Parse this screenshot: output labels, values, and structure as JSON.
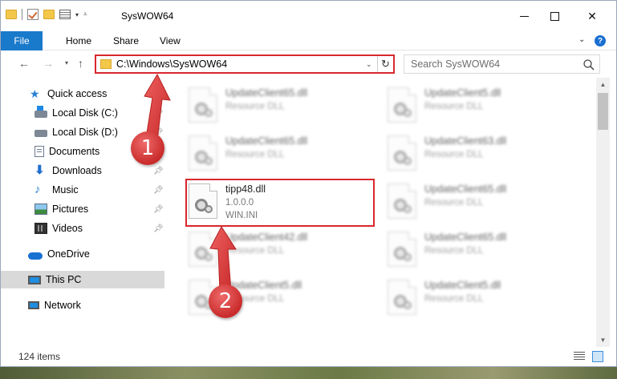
{
  "window": {
    "title": "SysWOW64"
  },
  "ribbon": {
    "tabs": [
      "File",
      "Home",
      "Share",
      "View"
    ],
    "help": "?"
  },
  "navigation": {
    "address": "C:\\Windows\\SysWOW64",
    "search_placeholder": "Search SysWOW64"
  },
  "sidebar": {
    "items": [
      {
        "label": "Quick access",
        "icon": "star-icon"
      },
      {
        "label": "Local Disk (C:)",
        "icon": "drive-icon",
        "pinned": true
      },
      {
        "label": "Local Disk (D:)",
        "icon": "drive-icon",
        "pinned": true
      },
      {
        "label": "Documents",
        "icon": "documents-icon",
        "pinned": true
      },
      {
        "label": "Downloads",
        "icon": "downloads-icon",
        "pinned": true
      },
      {
        "label": "Music",
        "icon": "music-icon",
        "pinned": true
      },
      {
        "label": "Pictures",
        "icon": "pictures-icon",
        "pinned": true
      },
      {
        "label": "Videos",
        "icon": "videos-icon",
        "pinned": true
      },
      {
        "label": "OneDrive",
        "icon": "onedrive-icon"
      },
      {
        "label": "This PC",
        "icon": "pc-icon",
        "selected": true
      },
      {
        "label": "Network",
        "icon": "network-icon"
      }
    ]
  },
  "files": [
    {
      "name": "UpdateClient65.dll",
      "type": "Resource DLL",
      "blurred": true
    },
    {
      "name": "UpdateClient5.dll",
      "type": "Resource DLL",
      "blurred": true
    },
    {
      "name": "UpdateClient65.dll",
      "type": "Resource DLL",
      "blurred": true
    },
    {
      "name": "UpdateClient63.dll",
      "type": "Resource DLL",
      "blurred": true
    },
    {
      "name": "tipp48.dll",
      "version": "1.0.0.0",
      "type": "WIN.INI",
      "blurred": false
    },
    {
      "name": "UpdateClient65.dll",
      "type": "Resource DLL",
      "blurred": true
    },
    {
      "name": "UpdateClient42.dll",
      "type": "Resource DLL",
      "blurred": true
    },
    {
      "name": "UpdateClient65.dll",
      "type": "Resource DLL",
      "blurred": true
    },
    {
      "name": "UpdateClient5.dll",
      "type": "Resource DLL",
      "blurred": true
    },
    {
      "name": "UpdateClient5.dll",
      "type": "Resource DLL",
      "blurred": true
    }
  ],
  "status": {
    "item_count": "124 items"
  },
  "annotations": {
    "step1": "1",
    "step2": "2",
    "color": "#d8282d"
  }
}
